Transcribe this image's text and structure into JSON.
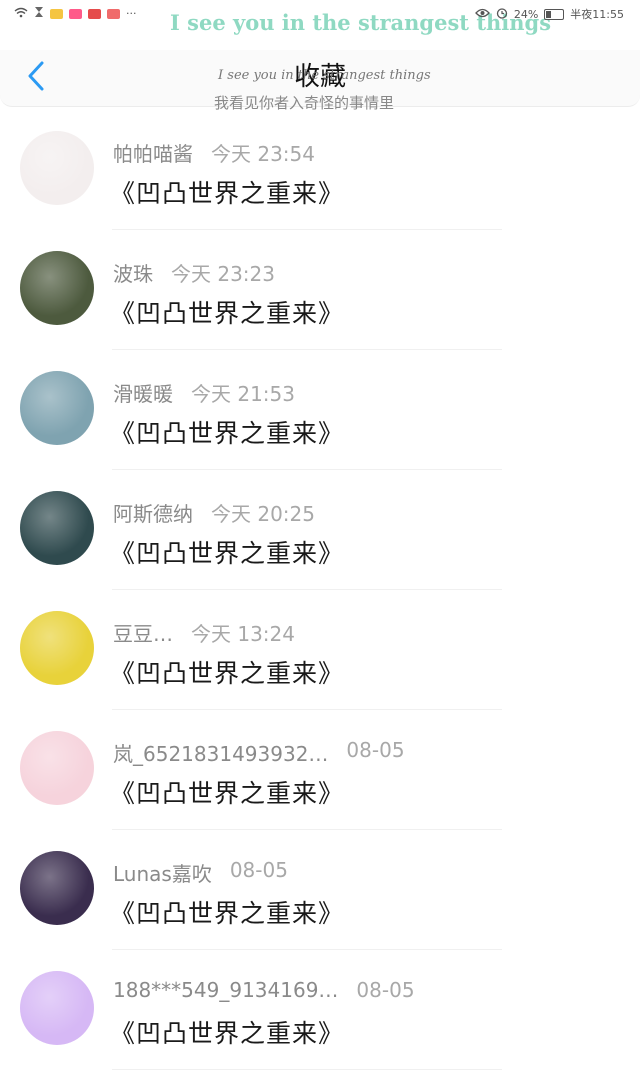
{
  "statusbar": {
    "marquee": "I see you in the strangest things",
    "battery_text": "24%",
    "time": "半夜11:55"
  },
  "header": {
    "title": "收藏",
    "overlay_en": "I see you in the strangest things",
    "overlay_cn": "我看见你者入奇怪的事情里"
  },
  "items": [
    {
      "name": "帕帕喵酱",
      "time": "今天 23:54",
      "work": "《凹凸世界之重来》",
      "avatar_color": "#f3eeee"
    },
    {
      "name": "波珠",
      "time": "今天 23:23",
      "work": "《凹凸世界之重来》",
      "avatar_color": "#4d5a3e"
    },
    {
      "name": "滑暖暖",
      "time": "今天 21:53",
      "work": "《凹凸世界之重来》",
      "avatar_color": "#7fa3b0"
    },
    {
      "name": "阿斯德纳",
      "time": "今天 20:25",
      "work": "《凹凸世界之重来》",
      "avatar_color": "#2f4a4e"
    },
    {
      "name": "豆豆…",
      "time": "今天 13:24",
      "work": "《凹凸世界之重来》",
      "avatar_color": "#e8d23a"
    },
    {
      "name": "岚_6521831493932…",
      "time": "08-05",
      "work": "《凹凸世界之重来》",
      "avatar_color": "#f6d3dc"
    },
    {
      "name": "Lunas嘉吹",
      "time": "08-05",
      "work": "《凹凸世界之重来》",
      "avatar_color": "#3a2d4e"
    },
    {
      "name": "188***549_9134169…",
      "time": "08-05",
      "work": "《凹凸世界之重来》",
      "avatar_color": "#d6b8f5"
    }
  ]
}
